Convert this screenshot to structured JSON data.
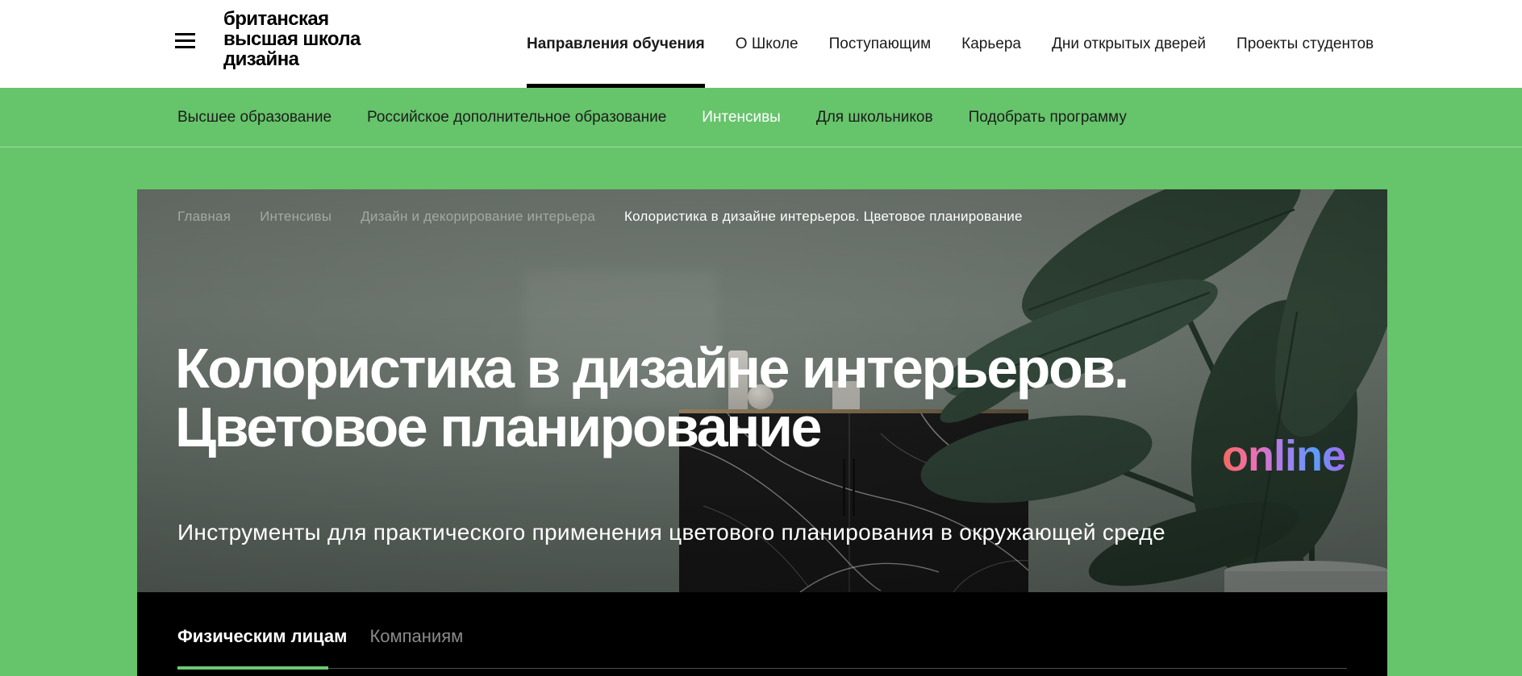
{
  "header": {
    "logo_lines": [
      "британская",
      "высшая школа",
      "дизайна"
    ],
    "nav": [
      {
        "label": "Направления обучения",
        "active": true
      },
      {
        "label": "О Школе",
        "active": false
      },
      {
        "label": "Поступающим",
        "active": false
      },
      {
        "label": "Карьера",
        "active": false
      },
      {
        "label": "Дни открытых дверей",
        "active": false
      },
      {
        "label": "Проекты студентов",
        "active": false
      }
    ]
  },
  "subnav": {
    "items": [
      {
        "label": "Высшее образование",
        "active": false
      },
      {
        "label": "Российское дополнительное образование",
        "active": false
      },
      {
        "label": "Интенсивы",
        "active": true
      },
      {
        "label": "Для школьников",
        "active": false
      },
      {
        "label": "Подобрать программу",
        "active": false
      }
    ]
  },
  "hero": {
    "breadcrumbs": [
      {
        "label": "Главная"
      },
      {
        "label": "Интенсивы"
      },
      {
        "label": "Дизайн и декорирование интерьера"
      }
    ],
    "breadcrumb_current": "Колористика в дизайне интерьеров. Цветовое планирование",
    "title_line1": "Колористика в дизайне интерьеров.",
    "title_line2": "Цветовое планирование",
    "online_badge": "online",
    "subtitle": "Инструменты для практического применения цветового планирования в окружающей среде"
  },
  "tabs": {
    "items": [
      {
        "label": "Физическим лицам",
        "active": true
      },
      {
        "label": "Компаниям",
        "active": false
      }
    ]
  },
  "colors": {
    "accent_green": "#66c46b",
    "subnav_divider": "#a6daa8",
    "tab_underline_green": "#6ec773",
    "hero_wall": "#6d7770",
    "tabs_bar_bg": "#000000",
    "online_gradient": [
      "#f4695e",
      "#f06fb0",
      "#a97df0",
      "#5d9cf8",
      "#a868ee"
    ]
  }
}
